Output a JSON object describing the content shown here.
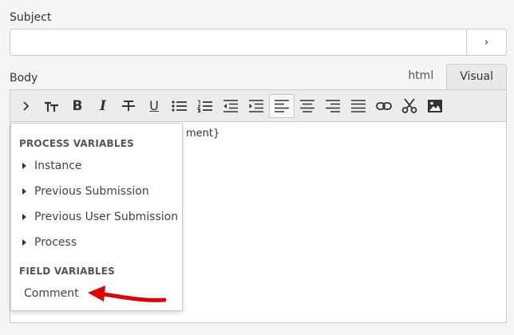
{
  "form": {
    "subject_label": "Subject",
    "subject_value": "",
    "subject_button": "›",
    "body_label": "Body"
  },
  "tabs": [
    {
      "label": "html",
      "active": false
    },
    {
      "label": "Visual",
      "active": true
    }
  ],
  "toolbar": {
    "icons": [
      "chevron-right-icon",
      "text-size-icon",
      "bold-icon",
      "italic-icon",
      "strikethrough-icon",
      "underline-icon",
      "bullet-list-icon",
      "numbered-list-icon",
      "outdent-icon",
      "indent-icon",
      "align-left-icon",
      "align-center-icon",
      "align-right-icon",
      "align-justify-icon",
      "link-icon",
      "cut-icon",
      "image-icon"
    ],
    "bold_glyph": "B",
    "italic_glyph": "I",
    "underline_glyph": "U",
    "active_tool": "align-left-icon"
  },
  "editor": {
    "content_fragment": "ment}"
  },
  "dropdown": {
    "process_header": "PROCESS VARIABLES",
    "process_items": [
      "Instance",
      "Previous Submission",
      "Previous User Submission",
      "Process"
    ],
    "field_header": "FIELD VARIABLES",
    "field_items": [
      "Comment"
    ]
  },
  "annotation": {
    "arrow_color": "#e00000"
  }
}
